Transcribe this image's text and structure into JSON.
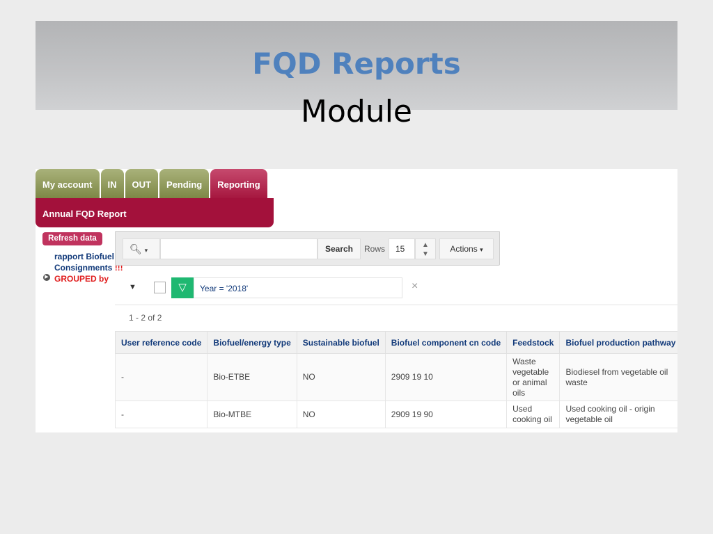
{
  "slide": {
    "title": "FQD Reports",
    "subtitle": "Module"
  },
  "nav": {
    "tabs": [
      {
        "label": "My account"
      },
      {
        "label": "IN"
      },
      {
        "label": "OUT"
      },
      {
        "label": "Pending"
      },
      {
        "label": "Reporting"
      }
    ],
    "active_tab": "Reporting",
    "subnav_label": "Annual FQD Report"
  },
  "sidebar": {
    "refresh_label": "Refresh data",
    "link_text": "rapport Biofuel Consignments",
    "link_warning": "!!! GROUPED by"
  },
  "toolbar": {
    "search_value": "",
    "search_button": "Search",
    "rows_label": "Rows",
    "rows_value": "15",
    "actions_label": "Actions"
  },
  "filter": {
    "text": "Year = '2018'",
    "remove_symbol": "×"
  },
  "pagination": "1 - 2 of 2",
  "table": {
    "headers": [
      "User reference code",
      "Biofuel/energy type",
      "Sustainable biofuel",
      "Biofuel component cn code",
      "Feedstock",
      "Biofuel production pathway"
    ],
    "rows": [
      [
        "-",
        "Bio-ETBE",
        "NO",
        "2909 19 10",
        "Waste vegetable or animal oils",
        "Biodiesel from vegetable oil waste"
      ],
      [
        "-",
        "Bio-MTBE",
        "NO",
        "2909 19 90",
        "Used cooking oil",
        "Used cooking oil - origin vegetable oil"
      ]
    ]
  },
  "colors": {
    "tab_green": "#8a9452",
    "tab_active": "#a6173f",
    "filter_green": "#1fb871",
    "title_blue": "#4f81bd"
  }
}
